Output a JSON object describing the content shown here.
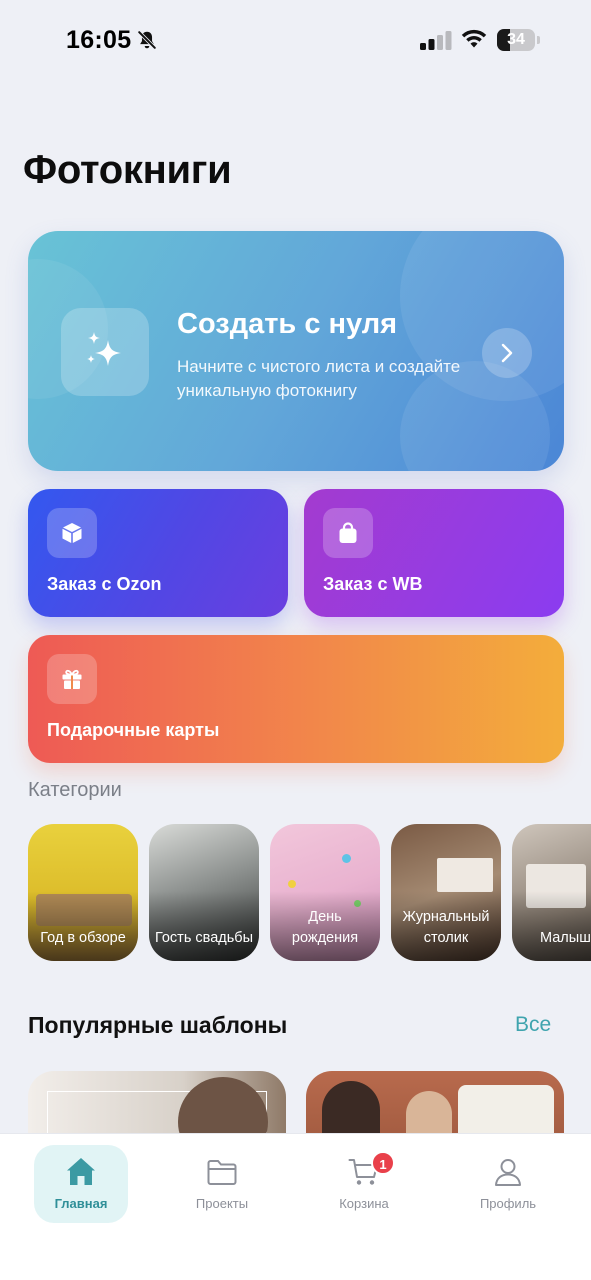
{
  "status_bar": {
    "time": "16:05",
    "battery": "34",
    "battery_level": 0.34
  },
  "page": {
    "title": "Фотокниги"
  },
  "hero": {
    "title": "Создать с нуля",
    "subtitle": "Начните с чистого листа и создайте уникальную фотокнигу",
    "icon": "sparkles-icon",
    "arrow_icon": "chevron-right-icon"
  },
  "actions": {
    "ozon": {
      "label": "Заказ с Ozon",
      "icon": "box-icon"
    },
    "wb": {
      "label": "Заказ с WB",
      "icon": "shopping-bag-icon"
    },
    "gift": {
      "label": "Подарочные карты",
      "icon": "gift-icon"
    }
  },
  "categories": {
    "title": "Категории",
    "items": [
      {
        "label": "Год в обзоре"
      },
      {
        "label": "Гость свадьбы"
      },
      {
        "label": "День рождения"
      },
      {
        "label": "Журнальный столик"
      },
      {
        "label": "Малыш"
      }
    ]
  },
  "popular": {
    "title": "Популярные шаблоны",
    "all_label": "Все"
  },
  "tab_bar": {
    "home": "Главная",
    "projects": "Проекты",
    "cart": "Корзина",
    "cart_badge": "1",
    "profile": "Профиль"
  },
  "colors": {
    "accent": "#3fa4ae",
    "badge": "#e9404a",
    "background": "#eef0f6"
  }
}
